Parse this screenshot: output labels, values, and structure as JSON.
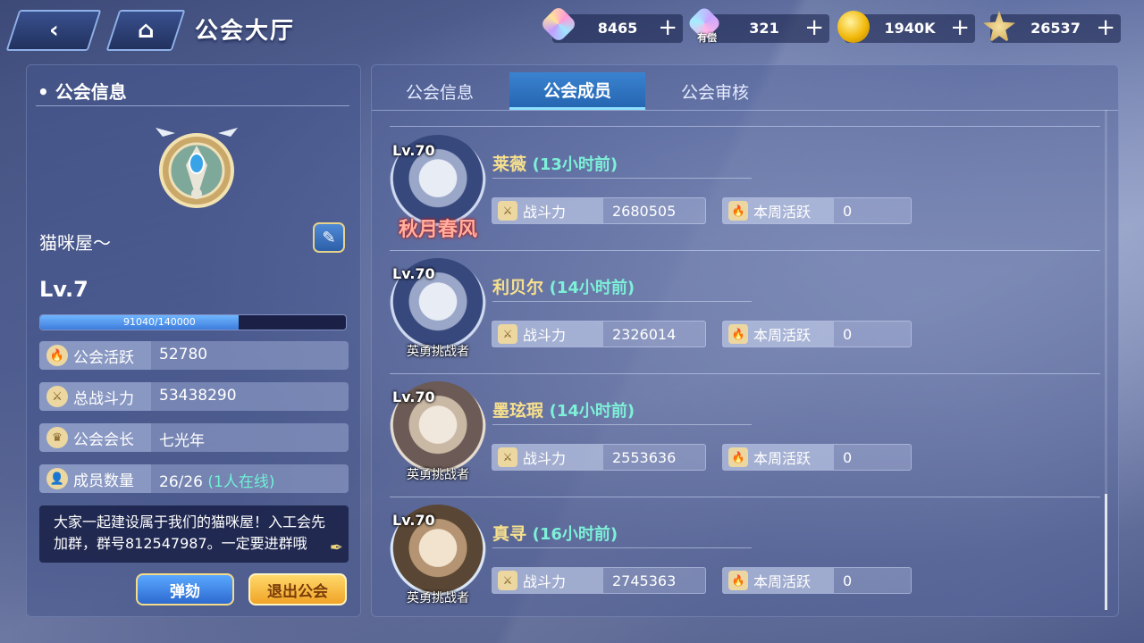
{
  "header": {
    "title": "公会大厅",
    "back_icon": "‹",
    "home_icon": "⌂"
  },
  "currencies": [
    {
      "name": "gem",
      "value": "8465",
      "bound_tag": ""
    },
    {
      "name": "bound-gem",
      "value": "321",
      "bound_tag": "有偿"
    },
    {
      "name": "gold",
      "value": "1940K",
      "bound_tag": ""
    },
    {
      "name": "star-medal",
      "value": "26537",
      "bound_tag": ""
    }
  ],
  "plus": "+",
  "guild": {
    "section_title": "公会信息",
    "name": "猫咪屋～",
    "level": "Lv.7",
    "exp_text": "91040/140000",
    "exp_fraction": 0.65,
    "stats": [
      {
        "label": "公会活跃",
        "value": "52780"
      },
      {
        "label": "总战斗力",
        "value": "53438290"
      },
      {
        "label": "公会会长",
        "value": "七光年"
      },
      {
        "label": "成员数量",
        "value": "26/26",
        "extra": "(1人在线)"
      }
    ],
    "notice": "大家一起建设属于我们的猫咪屋！入工会先加群，群号812547987。一定要进群哦",
    "kick_label": "弹劾",
    "quit_label": "退出公会"
  },
  "tabs": [
    {
      "label": "公会信息"
    },
    {
      "label": "公会成员"
    },
    {
      "label": "公会审核"
    }
  ],
  "members": [
    {
      "name": "莱薇",
      "time": "(13小时前)",
      "level": "Lv.70",
      "title": "秋月春风",
      "power_label": "战斗力",
      "power": "2680505",
      "active_label": "本周活跃",
      "active": "0"
    },
    {
      "name": "利贝尔",
      "time": "(14小时前)",
      "level": "Lv.70",
      "title": "英勇挑战者",
      "power_label": "战斗力",
      "power": "2326014",
      "active_label": "本周活跃",
      "active": "0"
    },
    {
      "name": "墨玹瑕",
      "time": "(14小时前)",
      "level": "Lv.70",
      "title": "英勇挑战者",
      "power_label": "战斗力",
      "power": "2553636",
      "active_label": "本周活跃",
      "active": "0"
    },
    {
      "name": "真寻",
      "time": "(16小时前)",
      "level": "Lv.70",
      "title": "英勇挑战者",
      "power_label": "战斗力",
      "power": "2745363",
      "active_label": "本周活跃",
      "active": "0"
    }
  ]
}
